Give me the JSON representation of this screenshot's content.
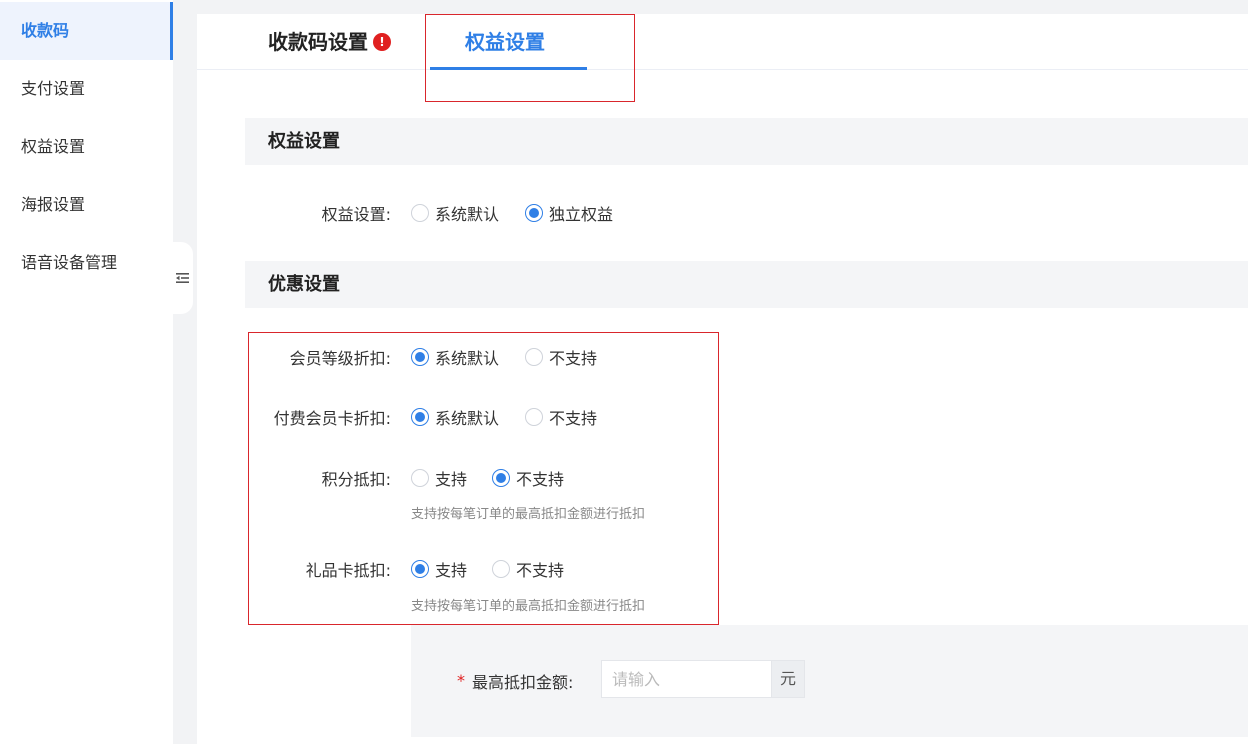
{
  "sidebar": {
    "items": [
      {
        "label": "收款码",
        "active": true
      },
      {
        "label": "支付设置",
        "active": false
      },
      {
        "label": "权益设置",
        "active": false
      },
      {
        "label": "海报设置",
        "active": false
      },
      {
        "label": "语音设备管理",
        "active": false
      }
    ]
  },
  "tabs": [
    {
      "label": "收款码设置",
      "alert": "!"
    },
    {
      "label": "权益设置"
    }
  ],
  "rights_section": {
    "title": "权益设置",
    "label": "权益设置:",
    "options": [
      "系统默认",
      "独立权益"
    ],
    "selected": "独立权益"
  },
  "discount_section": {
    "title": "优惠设置",
    "rows": [
      {
        "label": "会员等级折扣:",
        "options": [
          "系统默认",
          "不支持"
        ],
        "selected": "系统默认"
      },
      {
        "label": "付费会员卡折扣:",
        "options": [
          "系统默认",
          "不支持"
        ],
        "selected": "系统默认"
      },
      {
        "label": "积分抵扣:",
        "options": [
          "支持",
          "不支持"
        ],
        "selected": "不支持",
        "hint": "支持按每笔订单的最高抵扣金额进行抵扣"
      },
      {
        "label": "礼品卡抵扣:",
        "options": [
          "支持",
          "不支持"
        ],
        "selected": "支持",
        "hint": "支持按每笔订单的最高抵扣金额进行抵扣"
      }
    ]
  },
  "max_deduction": {
    "required_mark": "*",
    "label": "最高抵扣金额:",
    "placeholder": "请输入",
    "suffix": "元"
  },
  "colors": {
    "accent": "#2f7fe6",
    "alert": "#e02020",
    "highlight_frame": "#d9262c"
  }
}
